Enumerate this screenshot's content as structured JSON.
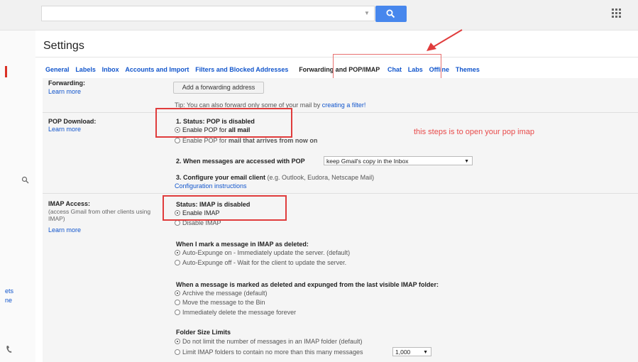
{
  "search": {
    "placeholder": ""
  },
  "left": {
    "text1": "ets",
    "text2": "ne"
  },
  "page": {
    "title": "Settings"
  },
  "tabs": [
    {
      "label": "General"
    },
    {
      "label": "Labels"
    },
    {
      "label": "Inbox"
    },
    {
      "label": "Accounts and Import"
    },
    {
      "label": "Filters and Blocked Addresses"
    },
    {
      "label": "Forwarding and POP/IMAP"
    },
    {
      "label": "Chat"
    },
    {
      "label": "Labs"
    },
    {
      "label": "Offline"
    },
    {
      "label": "Themes"
    }
  ],
  "forwarding": {
    "label": "Forwarding:",
    "learn": "Learn more",
    "button": "Add a forwarding address",
    "tip_prefix": "Tip: You can also forward only some of your mail by",
    "tip_link": "creating a filter!"
  },
  "pop": {
    "label": "POP Download:",
    "learn": "Learn more",
    "status": "1. Status: POP is disabled",
    "opt1_prefix": "Enable POP for",
    "opt1_bold": "all mail",
    "opt2_prefix": "Enable POP for",
    "opt2_bold": "mail that arrives from now on",
    "step2": "2. When messages are accessed with POP",
    "step2_select": "keep Gmail's copy in the Inbox",
    "step3_bold": "3. Configure your email client",
    "step3_rest": "(e.g. Outlook, Eudora, Netscape Mail)",
    "config_link": "Configuration instructions"
  },
  "annotation": "this steps is to open your pop imap",
  "imap": {
    "label": "IMAP Access:",
    "desc": "(access Gmail from other clients using IMAP)",
    "learn": "Learn more",
    "status": "Status: IMAP is disabled",
    "enable": "Enable IMAP",
    "disable": "Disable IMAP",
    "deleted_heading": "When I mark a message in IMAP as deleted:",
    "deleted_opt1": "Auto-Expunge on - Immediately update the server. (default)",
    "deleted_opt2": "Auto-Expunge off - Wait for the client to update the server.",
    "expunged_heading": "When a message is marked as deleted and expunged from the last visible IMAP folder:",
    "expunged_opt1": "Archive the message (default)",
    "expunged_opt2": "Move the message to the Bin",
    "expunged_opt3": "Immediately delete the message forever",
    "folder_heading": "Folder Size Limits",
    "folder_opt1": "Do not limit the number of messages in an IMAP folder (default)",
    "folder_opt2": "Limit IMAP folders to contain no more than this many messages",
    "folder_select": "1,000"
  },
  "colors": {
    "accent_blue": "#4787ed",
    "link": "#1155cc",
    "highlight_red": "#e03c3c"
  }
}
